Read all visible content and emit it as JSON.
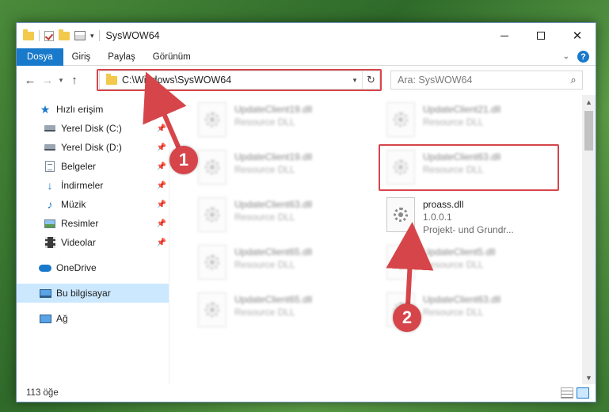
{
  "window": {
    "title": "SysWOW64"
  },
  "ribbon": {
    "tabs": [
      {
        "label": "Dosya",
        "active": true
      },
      {
        "label": "Giriş"
      },
      {
        "label": "Paylaş"
      },
      {
        "label": "Görünüm"
      }
    ],
    "help": "?"
  },
  "nav": {
    "address": "C:\\Windows\\SysWOW64",
    "search_placeholder": "Ara: SysWOW64"
  },
  "sidebar": {
    "quick_access": "Hızlı erişim",
    "items": [
      {
        "label": "Yerel Disk (C:)",
        "icon": "drive-icon"
      },
      {
        "label": "Yerel Disk (D:)",
        "icon": "drive-icon"
      },
      {
        "label": "Belgeler",
        "icon": "documents-icon"
      },
      {
        "label": "İndirmeler",
        "icon": "downloads-icon"
      },
      {
        "label": "Müzik",
        "icon": "music-icon"
      },
      {
        "label": "Resimler",
        "icon": "pictures-icon"
      },
      {
        "label": "Videolar",
        "icon": "videos-icon"
      }
    ],
    "onedrive": "OneDrive",
    "this_pc": "Bu bilgisayar",
    "network": "Ağ"
  },
  "files": [
    {
      "name": "UpdateClient19.dll",
      "sub": "Resource DLL",
      "blurred": true
    },
    {
      "name": "UpdateClient21.dll",
      "sub": "Resource DLL",
      "blurred": true
    },
    {
      "name": "UpdateClient19.dll",
      "sub": "Resource DLL",
      "blurred": true
    },
    {
      "name": "UpdateClient63.dll",
      "sub": "Resource DLL",
      "blurred": true
    },
    {
      "name": "UpdateClient63.dll",
      "sub": "Resource DLL",
      "blurred": true
    },
    {
      "name": "proass.dll",
      "version": "1.0.0.1",
      "sub": "Projekt- und Grundr...",
      "blurred": false
    },
    {
      "name": "UpdateClient65.dll",
      "sub": "Resource DLL",
      "blurred": true
    },
    {
      "name": "UpdateClient5.dll",
      "sub": "Resource DLL",
      "blurred": true
    },
    {
      "name": "UpdateClient65.dll",
      "sub": "Resource DLL",
      "blurred": true
    },
    {
      "name": "UpdateClient63.dll",
      "sub": "Resource DLL",
      "blurred": true
    }
  ],
  "status": {
    "count": "113 öğe"
  },
  "annotations": {
    "step1": "1",
    "step2": "2"
  },
  "colors": {
    "accent": "#1979ca",
    "annotation": "#d6454a"
  }
}
